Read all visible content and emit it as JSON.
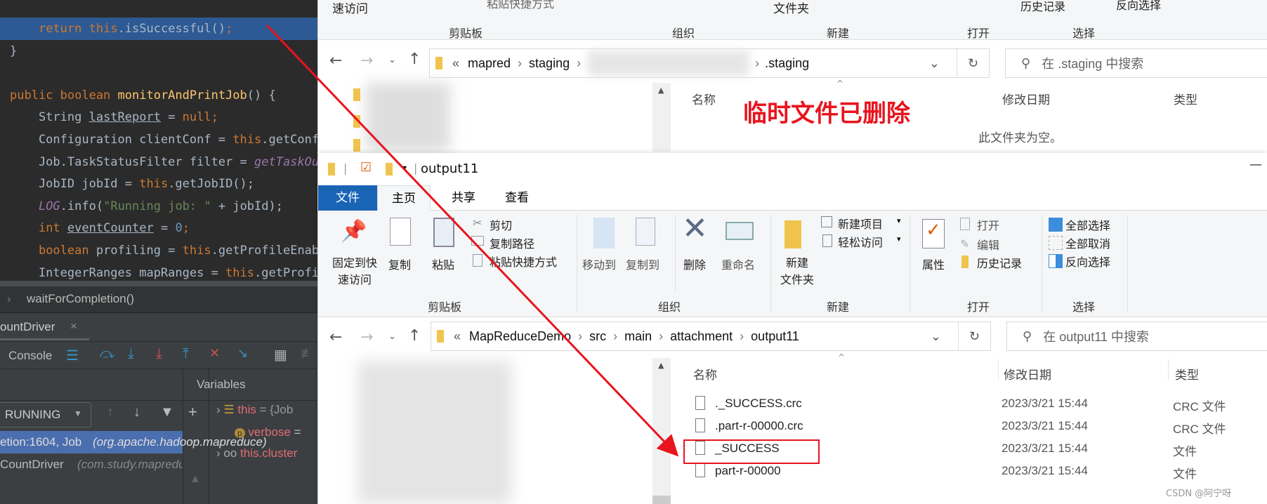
{
  "editor": {
    "lines": [
      {
        "parts": [
          [
            "    ",
            ""
          ],
          [
            "return ",
            "kw"
          ],
          [
            "this",
            "kw"
          ],
          [
            ".isSuccessful()",
            ""
          ],
          [
            ";",
            "kw"
          ]
        ]
      },
      {
        "parts": [
          [
            "}",
            ""
          ]
        ]
      },
      {
        "parts": []
      },
      {
        "parts": [
          [
            "public boolean ",
            "kw"
          ],
          [
            "monitorAndPrintJob",
            "fn"
          ],
          [
            "() {",
            ""
          ]
        ]
      },
      {
        "parts": [
          [
            "    String ",
            ""
          ],
          [
            "lastReport",
            "ul"
          ],
          [
            " = ",
            ""
          ],
          [
            "null;",
            "kw"
          ]
        ]
      },
      {
        "parts": [
          [
            "    Configuration clientConf = ",
            ""
          ],
          [
            "this",
            "kw"
          ],
          [
            ".getConfiguration();",
            ""
          ]
        ]
      },
      {
        "parts": [
          [
            "    Job.TaskStatusFilter filter = ",
            ""
          ],
          [
            "getTaskOutputFilter",
            "it"
          ]
        ]
      },
      {
        "parts": [
          [
            "    JobID jobId = ",
            ""
          ],
          [
            "this",
            "kw"
          ],
          [
            ".getJobID();",
            ""
          ]
        ]
      },
      {
        "parts": [
          [
            "    ",
            ""
          ],
          [
            "LOG",
            "it"
          ],
          [
            ".info(",
            ""
          ],
          [
            "\"Running job: \"",
            "str"
          ],
          [
            " + jobId);",
            ""
          ]
        ]
      },
      {
        "parts": [
          [
            "    ",
            ""
          ],
          [
            "int ",
            "kw"
          ],
          [
            "eventCounter",
            "ul"
          ],
          [
            " = ",
            ""
          ],
          [
            "0",
            "num"
          ],
          [
            ";",
            "kw"
          ]
        ]
      },
      {
        "parts": [
          [
            "    ",
            ""
          ],
          [
            "boolean ",
            "kw"
          ],
          [
            "profiling = ",
            ""
          ],
          [
            "this",
            "kw"
          ],
          [
            ".getProfileEnabled();",
            ""
          ]
        ]
      },
      {
        "parts": [
          [
            "    IntegerRanges mapRanges = ",
            ""
          ],
          [
            "this",
            "kw"
          ],
          [
            ".getProfileTaskRange(true);",
            ""
          ]
        ]
      }
    ],
    "breadcrumb": "waitForCompletion()",
    "run_tab": "ountDriver",
    "console_label": "Console",
    "variables_label": "Variables",
    "thread_state": "RUNNING",
    "frames": [
      {
        "text": "etion:1604, Job ",
        "pkg": "(org.apache.hadoop.mapreduce)"
      },
      {
        "text": "CountDriver ",
        "pkg": "(com.study.mapreduce)"
      }
    ],
    "variables": [
      {
        "name": "this",
        "value": " = {Job"
      },
      {
        "name": "verbose",
        "value": " ="
      },
      {
        "name": "this.cluster",
        "value": ""
      }
    ]
  },
  "top_explorer": {
    "ribbon_partial": [
      "速访问",
      "粘贴快捷方式",
      "文件夹",
      "历史记录",
      "反向选择"
    ],
    "groups": [
      "剪贴板",
      "组织",
      "新建",
      "打开",
      "选择"
    ],
    "path": [
      "mapred",
      "staging",
      ".staging"
    ],
    "search_placeholder": "在 .staging 中搜索",
    "columns": [
      "名称",
      "修改日期",
      "类型"
    ],
    "empty_text": "此文件夹为空。"
  },
  "annotation": "临时文件已删除",
  "explorer": {
    "title": "output11",
    "tabs": [
      "文件",
      "主页",
      "共享",
      "查看"
    ],
    "ribbon": {
      "pin": "固定到快\n速访问",
      "copy": "复制",
      "paste": "粘贴",
      "cut": "剪切",
      "copy_path": "复制路径",
      "paste_shortcut": "粘贴快捷方式",
      "move_to": "移动到",
      "copy_to": "复制到",
      "delete": "删除",
      "rename": "重命名",
      "new_folder": "新建\n文件夹",
      "new_item": "新建项目",
      "easy_access": "轻松访问",
      "properties": "属性",
      "open": "打开",
      "edit": "编辑",
      "history": "历史记录",
      "select_all": "全部选择",
      "select_none": "全部取消",
      "invert": "反向选择"
    },
    "groups": [
      "剪贴板",
      "组织",
      "新建",
      "打开",
      "选择"
    ],
    "path": [
      "MapReduceDemo",
      "src",
      "main",
      "attachment",
      "output11"
    ],
    "search_placeholder": "在 output11 中搜索",
    "columns": [
      "名称",
      "修改日期",
      "类型"
    ],
    "files": [
      {
        "name": "._SUCCESS.crc",
        "date": "2023/3/21 15:44",
        "type": "CRC 文件"
      },
      {
        "name": ".part-r-00000.crc",
        "date": "2023/3/21 15:44",
        "type": "CRC 文件"
      },
      {
        "name": "_SUCCESS",
        "date": "2023/3/21 15:44",
        "type": "文件",
        "highlighted": true
      },
      {
        "name": "part-r-00000",
        "date": "2023/3/21 15:44",
        "type": "文件"
      }
    ]
  },
  "watermark": "CSDN @阿宁呀",
  "colors": {
    "annotation": "#e8141e",
    "selection": "#2d5a94"
  }
}
